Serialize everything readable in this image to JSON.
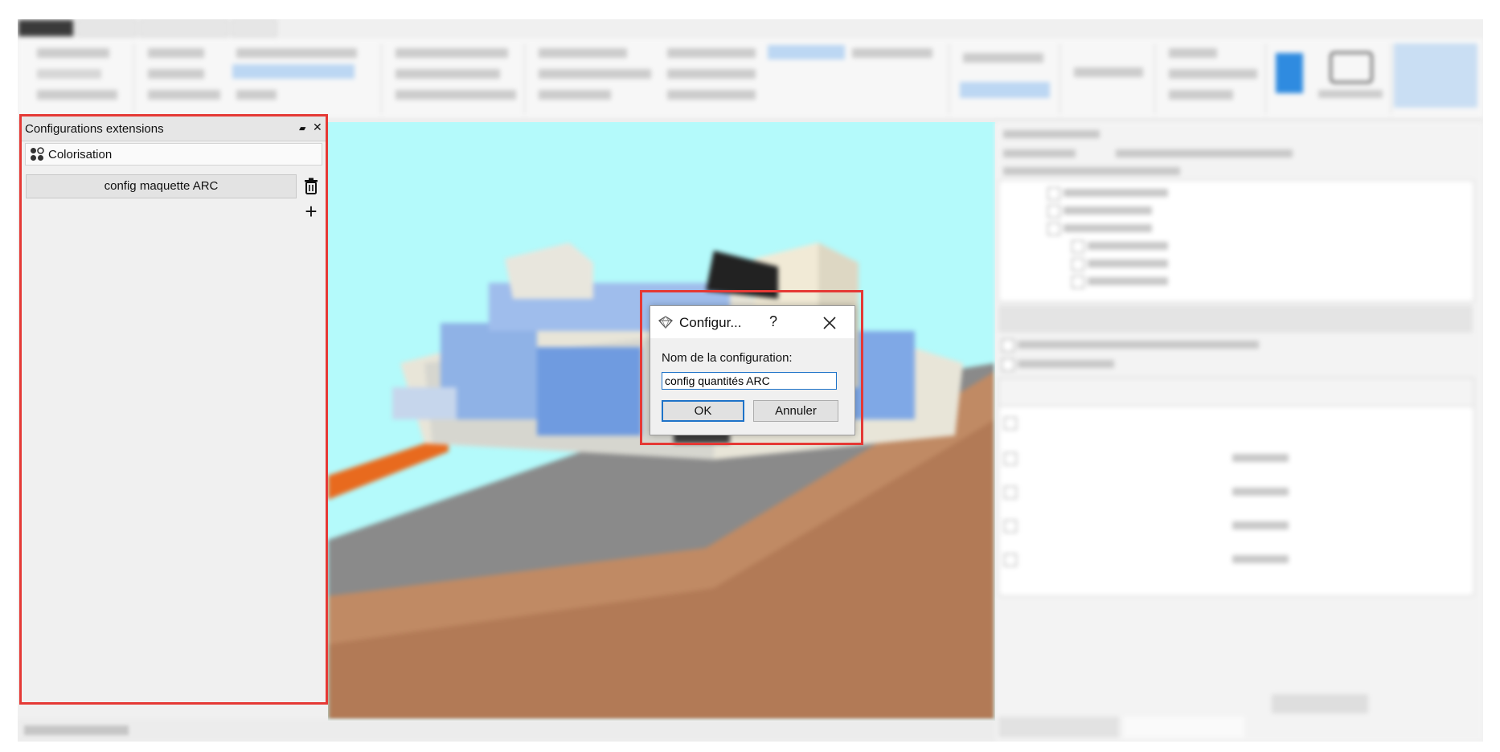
{
  "left_panel": {
    "title": "Configurations extensions",
    "float_glyph": "▰",
    "close_glyph": "✕",
    "extension_label": "Colorisation",
    "config_button_label": "config maquette ARC",
    "add_glyph": "+"
  },
  "dialog": {
    "title": "Configur...",
    "help_glyph": "?",
    "label": "Nom de la configuration:",
    "input_value": "config quantités ARC",
    "ok_label": "OK",
    "cancel_label": "Annuler"
  },
  "colors": {
    "highlight_outline": "#e53935",
    "viewport_background": "#b4fafb",
    "focus_blue": "#1e73c8"
  }
}
